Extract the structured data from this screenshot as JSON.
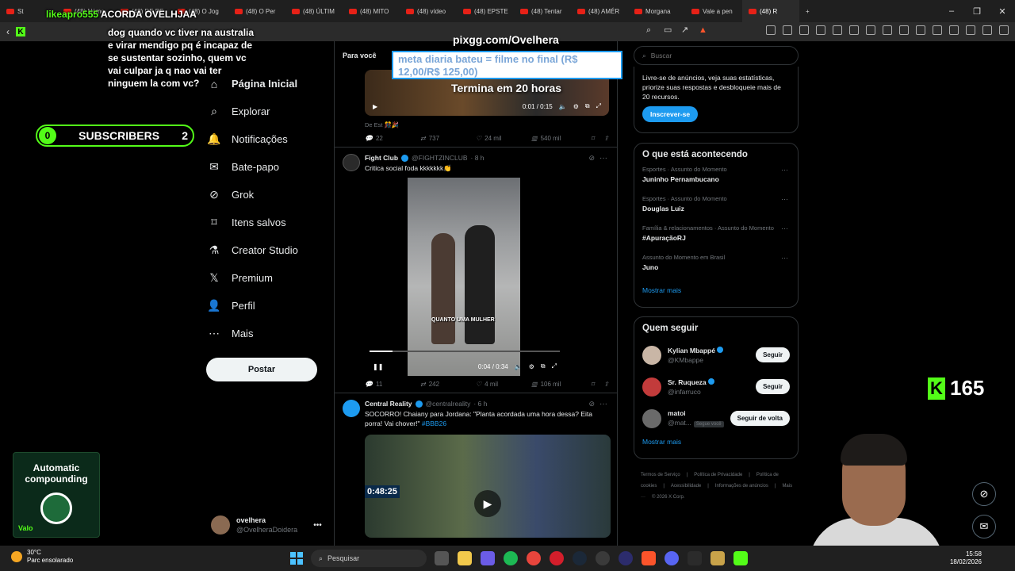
{
  "browser": {
    "tabs": [
      {
        "label": "St",
        "active": false
      },
      {
        "label": "(48) Núme",
        "active": false
      },
      {
        "label": "(48) DE PE",
        "active": false
      },
      {
        "label": "(48) O Jog",
        "active": false
      },
      {
        "label": "(48) O Per",
        "active": false
      },
      {
        "label": "(48) ÚLTIM",
        "active": false
      },
      {
        "label": "(48) MITO",
        "active": false
      },
      {
        "label": "(48) vídeo",
        "active": false
      },
      {
        "label": "(48) EPSTE",
        "active": false
      },
      {
        "label": "(48) Tentar",
        "active": false
      },
      {
        "label": "(48) AMÉR",
        "active": false
      },
      {
        "label": "Morgana",
        "active": false
      },
      {
        "label": "Vale a pen",
        "active": false
      },
      {
        "label": "(48)  R",
        "active": true
      }
    ],
    "new_tab": "+",
    "win_controls": [
      "–",
      "❐",
      "✕"
    ]
  },
  "sidebar": {
    "items": [
      {
        "label": "Página Inicial",
        "icon": "home-icon",
        "glyph": "⌂"
      },
      {
        "label": "Explorar",
        "icon": "search-icon",
        "glyph": "⌕"
      },
      {
        "label": "Notificações",
        "icon": "bell-icon",
        "glyph": "🔔"
      },
      {
        "label": "Bate-papo",
        "icon": "mail-icon",
        "glyph": "✉"
      },
      {
        "label": "Grok",
        "icon": "grok-icon",
        "glyph": "⊘"
      },
      {
        "label": "Itens salvos",
        "icon": "bookmark-icon",
        "glyph": "⌑"
      },
      {
        "label": "Creator Studio",
        "icon": "flask-icon",
        "glyph": "⚗"
      },
      {
        "label": "Premium",
        "icon": "x-logo-icon",
        "glyph": "𝕏"
      },
      {
        "label": "Perfil",
        "icon": "person-icon",
        "glyph": "👤"
      },
      {
        "label": "Mais",
        "icon": "more-circle-icon",
        "glyph": "⋯"
      }
    ],
    "post_label": "Postar",
    "profile": {
      "name": "ovelhera",
      "handle": "@OvelheraDoidera"
    }
  },
  "feed": {
    "tab_for_you": "Para você",
    "tweets": [
      {
        "text": "De Est 🎊🎉",
        "video_time": "0:01 / 0:15",
        "replies": "22",
        "reposts": "737",
        "likes": "24 mil",
        "views": "540 mil"
      },
      {
        "name": "Fight Club",
        "handle": "@FIGHTZINCLUB",
        "time": "· 8 h",
        "text": "Critica social foda kkkkkkk👏",
        "caption": "QUANTO UMA MULHER",
        "video_time": "0:04 / 0:34",
        "replies": "11",
        "reposts": "242",
        "likes": "4 mil",
        "views": "106 mil"
      },
      {
        "name": "Central Reality",
        "handle": "@centralreality",
        "time": "· 6 h",
        "text": "SOCORRO! Chaiany para Jordana: \"Planta acordada uma hora dessa? Eita porra! Vai chover!\"",
        "hashtag": "#BBB26",
        "clock": "0:48:25"
      }
    ]
  },
  "right": {
    "search_placeholder": "Buscar",
    "premium_text": "Livre-se de anúncios, veja suas estatísticas, priorize suas respostas e desbloqueie mais de 20 recursos.",
    "premium_button": "Inscrever-se",
    "trends_title": "O que está acontecendo",
    "trends": [
      {
        "context": "Esportes · Assunto do Momento",
        "topic": "Juninho Pernambucano"
      },
      {
        "context": "Esportes · Assunto do Momento",
        "topic": "Douglas Luiz"
      },
      {
        "context": "Família & relacionamentos · Assunto do Momento",
        "topic": "#ApuraçãoRJ"
      },
      {
        "context": "Assunto do Momento em Brasil",
        "topic": "Juno"
      }
    ],
    "show_more": "Mostrar mais",
    "follow_title": "Quem seguir",
    "follows": [
      {
        "name": "Kylian Mbappé",
        "handle": "@KMbappe",
        "button": "Seguir",
        "follows_you": ""
      },
      {
        "name": "Sr. Ruqueza",
        "handle": "@infarruco",
        "button": "Seguir",
        "follows_you": ""
      },
      {
        "name": "matoi",
        "handle": "@mat...",
        "button": "Seguir de volta",
        "follows_you": "Segue você"
      }
    ],
    "follow_show_more": "Mostrar mais",
    "footer": [
      "Termos de Serviço",
      "|",
      "Política de Privacidade",
      "|",
      "Política de cookies",
      "|",
      "Acessibilidade",
      "|",
      "Informações de anúncios",
      "|",
      "Mais ···",
      "© 2026 X Corp."
    ]
  },
  "overlay": {
    "chat_line1_user": "likeapro555",
    "chat_line1_text": "ACORDA OVELHJAA",
    "chat_msg": "dog quando vc tiver na australia e virar mendigo pq é incapaz de se sustentar sozinho, quem vc vai culpar ja q nao vai ter ninguem la com vc?",
    "sub_left": "0",
    "sub_label": "SUBSCRIBERS",
    "sub_right": "2",
    "pixgg": "pixgg.com/Ovelhera",
    "goal_text": "meta diaria bateu = filme no final (R$ 12,00/R$ 125,00)",
    "goal_timer": "Termina em 20 horas",
    "viewers": "165",
    "ad_title": "Automatic compounding",
    "ad_brand": "Valo"
  },
  "taskbar": {
    "temp": "30°C",
    "weather": "Parc ensolarado",
    "search": "Pesquisar",
    "time": "15:58",
    "date": "18/02/2026"
  }
}
